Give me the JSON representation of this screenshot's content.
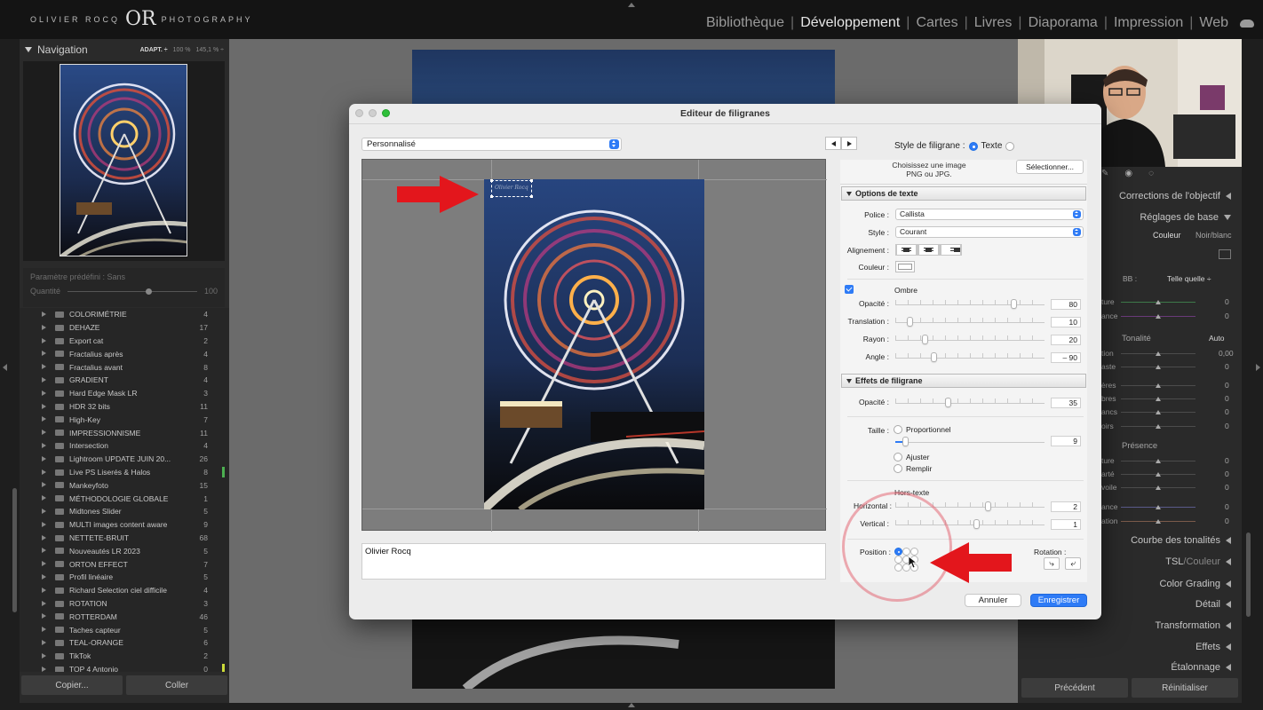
{
  "top_bar": {
    "logo_left": "OLIVIER ROCQ",
    "logo_mono": "OR",
    "logo_right": "PHOTOGRAPHY",
    "modules": [
      "Bibliothèque",
      "Développement",
      "Cartes",
      "Livres",
      "Diaporama",
      "Impression",
      "Web"
    ],
    "active_module": "Développement"
  },
  "navigator": {
    "title": "Navigation",
    "zoom_fit": "ADAPT. ÷",
    "zoom_100": "100 %",
    "zoom_145": "145,1 % ÷"
  },
  "preset_box": {
    "param_label": "Paramètre prédéfini : Sans",
    "quantity_label": "Quantité",
    "quantity_value": "100"
  },
  "presets": [
    {
      "name": "COLORIMÉTRIE",
      "count": "4"
    },
    {
      "name": "DEHAZE",
      "count": "17"
    },
    {
      "name": "Export cat",
      "count": "2"
    },
    {
      "name": "Fractalius après",
      "count": "4"
    },
    {
      "name": "Fractalius avant",
      "count": "8"
    },
    {
      "name": "GRADIENT",
      "count": "4"
    },
    {
      "name": "Hard Edge Mask LR",
      "count": "3"
    },
    {
      "name": "HDR 32 bits",
      "count": "11"
    },
    {
      "name": "High-Key",
      "count": "7"
    },
    {
      "name": "IMPRESSIONNISME",
      "count": "11"
    },
    {
      "name": "Intersection",
      "count": "4"
    },
    {
      "name": "Lightroom UPDATE JUIN 20...",
      "count": "26"
    },
    {
      "name": "Live PS Liserés & Halos",
      "count": "8",
      "marker": "green"
    },
    {
      "name": "Mankeyfoto",
      "count": "15"
    },
    {
      "name": "MÉTHODOLOGIE GLOBALE",
      "count": "1"
    },
    {
      "name": "Midtones Slider",
      "count": "5"
    },
    {
      "name": "MULTI images content aware",
      "count": "9"
    },
    {
      "name": "NETTETE-BRUIT",
      "count": "68"
    },
    {
      "name": "Nouveautés LR 2023",
      "count": "5"
    },
    {
      "name": "ORTON EFFECT",
      "count": "7"
    },
    {
      "name": "Profil linéaire",
      "count": "5"
    },
    {
      "name": "Richard Selection ciel difficile",
      "count": "4"
    },
    {
      "name": "ROTATION",
      "count": "3"
    },
    {
      "name": "ROTTERDAM",
      "count": "46"
    },
    {
      "name": "Taches capteur",
      "count": "5"
    },
    {
      "name": "TEAL-ORANGE",
      "count": "6"
    },
    {
      "name": "TikTok",
      "count": "2"
    },
    {
      "name": "TOP 4 Antonio",
      "count": "0",
      "marker": "yellow"
    }
  ],
  "left_buttons": {
    "copy": "Copier...",
    "paste": "Coller"
  },
  "right_panel": {
    "lens_corrections": "Corrections de l'objectif",
    "basic": "Réglages de base",
    "color": "Couleur",
    "bw": "Noir/blanc",
    "wb_label": "BB :",
    "wb_value": "Telle quelle ÷",
    "tone_label": "Tonalité",
    "tone_auto": "Auto",
    "presence_label": "Présence",
    "partial_labels_a": [
      "ture",
      "ance"
    ],
    "partial_labels_b": [
      "tion",
      "aste",
      "ères",
      "bres",
      "ancs",
      "oirs"
    ],
    "partial_labels_c": [
      "ture",
      "arté",
      "voile",
      "ance",
      "ation"
    ],
    "values_a": [
      "0",
      "0"
    ],
    "values_b": [
      "0,00",
      "0",
      "0",
      "0",
      "0",
      "0"
    ],
    "values_c": [
      "0",
      "0",
      "0",
      "0",
      "0"
    ],
    "tone_curve": "Courbe des tonalités",
    "hsl": "TSL",
    "hsl_sep": "/",
    "hsl_color": "Couleur",
    "color_grading": "Color Grading",
    "detail": "Détail",
    "transformation": "Transformation",
    "effects": "Effets",
    "calibration": "Étalonnage",
    "previous": "Précédent",
    "reset": "Réinitialiser"
  },
  "dialog": {
    "title": "Editeur de filigranes",
    "preset": "Personnalisé",
    "style_label": "Style de filigrane :",
    "style_text": "Texte",
    "image_choose": "Choisissez une image",
    "image_formats": "PNG ou JPG.",
    "select_button": "Sélectionner...",
    "watermark_text": "Olivier Rocq",
    "text_options": {
      "header": "Options de texte",
      "font_label": "Police :",
      "font_value": "Callista",
      "style_label": "Style :",
      "style_value": "Courant",
      "align_label": "Alignement :",
      "color_label": "Couleur :",
      "shadow_label": "Ombre",
      "opacity_label": "Opacité :",
      "opacity_value": "80",
      "offset_label": "Translation :",
      "offset_value": "10",
      "radius_label": "Rayon :",
      "radius_value": "20",
      "angle_label": "Angle :",
      "angle_value": "– 90"
    },
    "effects": {
      "header": "Effets de filigrane",
      "opacity_label": "Opacité :",
      "opacity_value": "35",
      "size_label": "Taille :",
      "proportional": "Proportionnel",
      "size_value": "9",
      "fit": "Ajuster",
      "fill": "Remplir",
      "inset_label": "Hors-texte",
      "horizontal_label": "Horizontal :",
      "horizontal_value": "2",
      "vertical_label": "Vertical :",
      "vertical_value": "1",
      "position_label": "Position :",
      "rotation_label": "Rotation :"
    },
    "cancel": "Annuler",
    "save": "Enregistrer"
  },
  "colors": {
    "accent": "#2e7bf6",
    "arrow": "#e3161c",
    "highlight_circle": "#e46976"
  }
}
